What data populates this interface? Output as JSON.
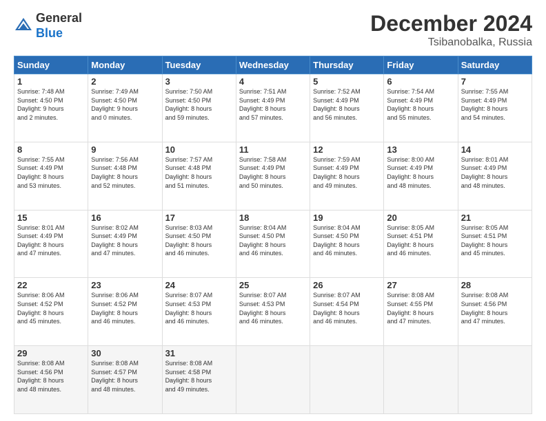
{
  "header": {
    "logo_line1": "General",
    "logo_line2": "Blue",
    "title": "December 2024",
    "subtitle": "Tsibanobalka, Russia"
  },
  "days_of_week": [
    "Sunday",
    "Monday",
    "Tuesday",
    "Wednesday",
    "Thursday",
    "Friday",
    "Saturday"
  ],
  "weeks": [
    [
      {
        "day": "1",
        "info": "Sunrise: 7:48 AM\nSunset: 4:50 PM\nDaylight: 9 hours\nand 2 minutes."
      },
      {
        "day": "2",
        "info": "Sunrise: 7:49 AM\nSunset: 4:50 PM\nDaylight: 9 hours\nand 0 minutes."
      },
      {
        "day": "3",
        "info": "Sunrise: 7:50 AM\nSunset: 4:50 PM\nDaylight: 8 hours\nand 59 minutes."
      },
      {
        "day": "4",
        "info": "Sunrise: 7:51 AM\nSunset: 4:49 PM\nDaylight: 8 hours\nand 57 minutes."
      },
      {
        "day": "5",
        "info": "Sunrise: 7:52 AM\nSunset: 4:49 PM\nDaylight: 8 hours\nand 56 minutes."
      },
      {
        "day": "6",
        "info": "Sunrise: 7:54 AM\nSunset: 4:49 PM\nDaylight: 8 hours\nand 55 minutes."
      },
      {
        "day": "7",
        "info": "Sunrise: 7:55 AM\nSunset: 4:49 PM\nDaylight: 8 hours\nand 54 minutes."
      }
    ],
    [
      {
        "day": "8",
        "info": "Sunrise: 7:55 AM\nSunset: 4:49 PM\nDaylight: 8 hours\nand 53 minutes."
      },
      {
        "day": "9",
        "info": "Sunrise: 7:56 AM\nSunset: 4:48 PM\nDaylight: 8 hours\nand 52 minutes."
      },
      {
        "day": "10",
        "info": "Sunrise: 7:57 AM\nSunset: 4:48 PM\nDaylight: 8 hours\nand 51 minutes."
      },
      {
        "day": "11",
        "info": "Sunrise: 7:58 AM\nSunset: 4:49 PM\nDaylight: 8 hours\nand 50 minutes."
      },
      {
        "day": "12",
        "info": "Sunrise: 7:59 AM\nSunset: 4:49 PM\nDaylight: 8 hours\nand 49 minutes."
      },
      {
        "day": "13",
        "info": "Sunrise: 8:00 AM\nSunset: 4:49 PM\nDaylight: 8 hours\nand 48 minutes."
      },
      {
        "day": "14",
        "info": "Sunrise: 8:01 AM\nSunset: 4:49 PM\nDaylight: 8 hours\nand 48 minutes."
      }
    ],
    [
      {
        "day": "15",
        "info": "Sunrise: 8:01 AM\nSunset: 4:49 PM\nDaylight: 8 hours\nand 47 minutes."
      },
      {
        "day": "16",
        "info": "Sunrise: 8:02 AM\nSunset: 4:49 PM\nDaylight: 8 hours\nand 47 minutes."
      },
      {
        "day": "17",
        "info": "Sunrise: 8:03 AM\nSunset: 4:50 PM\nDaylight: 8 hours\nand 46 minutes."
      },
      {
        "day": "18",
        "info": "Sunrise: 8:04 AM\nSunset: 4:50 PM\nDaylight: 8 hours\nand 46 minutes."
      },
      {
        "day": "19",
        "info": "Sunrise: 8:04 AM\nSunset: 4:50 PM\nDaylight: 8 hours\nand 46 minutes."
      },
      {
        "day": "20",
        "info": "Sunrise: 8:05 AM\nSunset: 4:51 PM\nDaylight: 8 hours\nand 46 minutes."
      },
      {
        "day": "21",
        "info": "Sunrise: 8:05 AM\nSunset: 4:51 PM\nDaylight: 8 hours\nand 45 minutes."
      }
    ],
    [
      {
        "day": "22",
        "info": "Sunrise: 8:06 AM\nSunset: 4:52 PM\nDaylight: 8 hours\nand 45 minutes."
      },
      {
        "day": "23",
        "info": "Sunrise: 8:06 AM\nSunset: 4:52 PM\nDaylight: 8 hours\nand 46 minutes."
      },
      {
        "day": "24",
        "info": "Sunrise: 8:07 AM\nSunset: 4:53 PM\nDaylight: 8 hours\nand 46 minutes."
      },
      {
        "day": "25",
        "info": "Sunrise: 8:07 AM\nSunset: 4:53 PM\nDaylight: 8 hours\nand 46 minutes."
      },
      {
        "day": "26",
        "info": "Sunrise: 8:07 AM\nSunset: 4:54 PM\nDaylight: 8 hours\nand 46 minutes."
      },
      {
        "day": "27",
        "info": "Sunrise: 8:08 AM\nSunset: 4:55 PM\nDaylight: 8 hours\nand 47 minutes."
      },
      {
        "day": "28",
        "info": "Sunrise: 8:08 AM\nSunset: 4:56 PM\nDaylight: 8 hours\nand 47 minutes."
      }
    ],
    [
      {
        "day": "29",
        "info": "Sunrise: 8:08 AM\nSunset: 4:56 PM\nDaylight: 8 hours\nand 48 minutes."
      },
      {
        "day": "30",
        "info": "Sunrise: 8:08 AM\nSunset: 4:57 PM\nDaylight: 8 hours\nand 48 minutes."
      },
      {
        "day": "31",
        "info": "Sunrise: 8:08 AM\nSunset: 4:58 PM\nDaylight: 8 hours\nand 49 minutes."
      },
      {
        "day": "",
        "info": ""
      },
      {
        "day": "",
        "info": ""
      },
      {
        "day": "",
        "info": ""
      },
      {
        "day": "",
        "info": ""
      }
    ]
  ]
}
